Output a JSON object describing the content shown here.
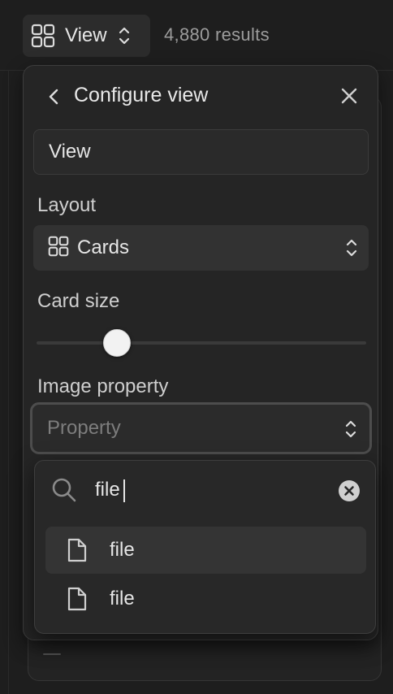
{
  "toolbar": {
    "view_label": "View",
    "results_text": "4,880 results"
  },
  "panel": {
    "title": "Configure view",
    "name_value": "View",
    "layout": {
      "label": "Layout",
      "selected": "Cards"
    },
    "card_size": {
      "label": "Card size",
      "value_fraction": 0.22
    },
    "image_property": {
      "label": "Image property",
      "placeholder": "Property"
    }
  },
  "dropdown": {
    "search_value": "file",
    "options": [
      {
        "label": "file",
        "icon": "file-icon",
        "highlighted": true
      },
      {
        "label": "file",
        "icon": "file-icon",
        "highlighted": false
      }
    ]
  },
  "colors": {
    "background": "#1e1e1e",
    "panel": "#252525",
    "text": "#e6e6e6",
    "muted": "#9c9c9c"
  }
}
